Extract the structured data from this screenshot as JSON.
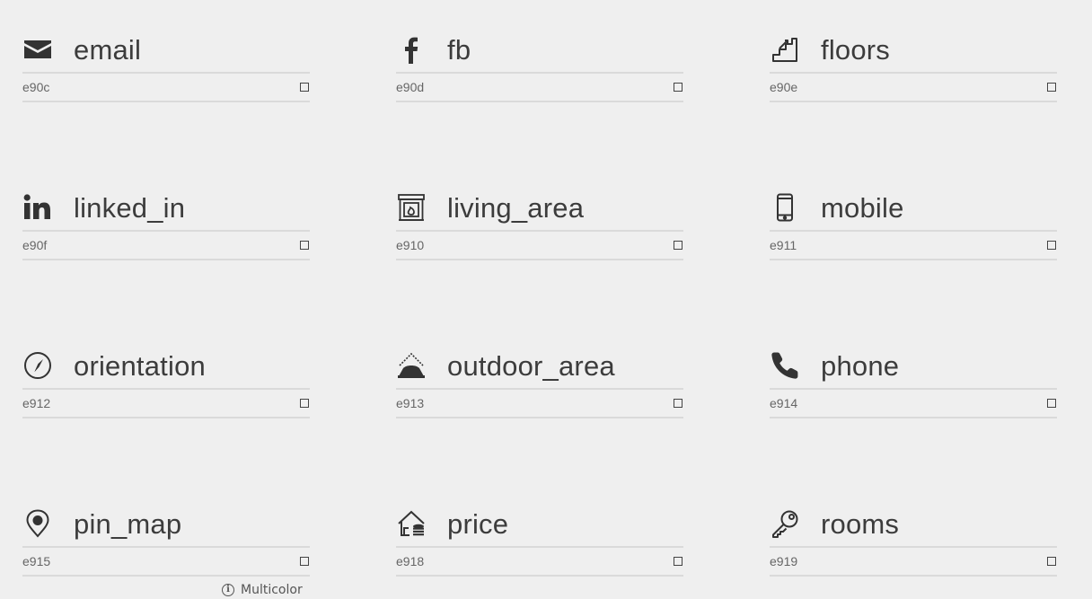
{
  "icons": [
    {
      "name": "email",
      "code": "e90c",
      "icon": "email-icon"
    },
    {
      "name": "fb",
      "code": "e90d",
      "icon": "fb-icon"
    },
    {
      "name": "floors",
      "code": "e90e",
      "icon": "floors-icon"
    },
    {
      "name": "linked_in",
      "code": "e90f",
      "icon": "linked-in-icon"
    },
    {
      "name": "living_area",
      "code": "e910",
      "icon": "living-area-icon"
    },
    {
      "name": "mobile",
      "code": "e911",
      "icon": "mobile-icon"
    },
    {
      "name": "orientation",
      "code": "e912",
      "icon": "orientation-icon"
    },
    {
      "name": "outdoor_area",
      "code": "e913",
      "icon": "outdoor-area-icon"
    },
    {
      "name": "phone",
      "code": "e914",
      "icon": "phone-icon"
    },
    {
      "name": "pin_map",
      "code": "e915",
      "icon": "pin-map-icon"
    },
    {
      "name": "price",
      "code": "e918",
      "icon": "price-icon"
    },
    {
      "name": "rooms",
      "code": "e919",
      "icon": "rooms-icon"
    }
  ],
  "footer": {
    "multicolor_label": "Multicolor",
    "info_glyph": "i"
  }
}
